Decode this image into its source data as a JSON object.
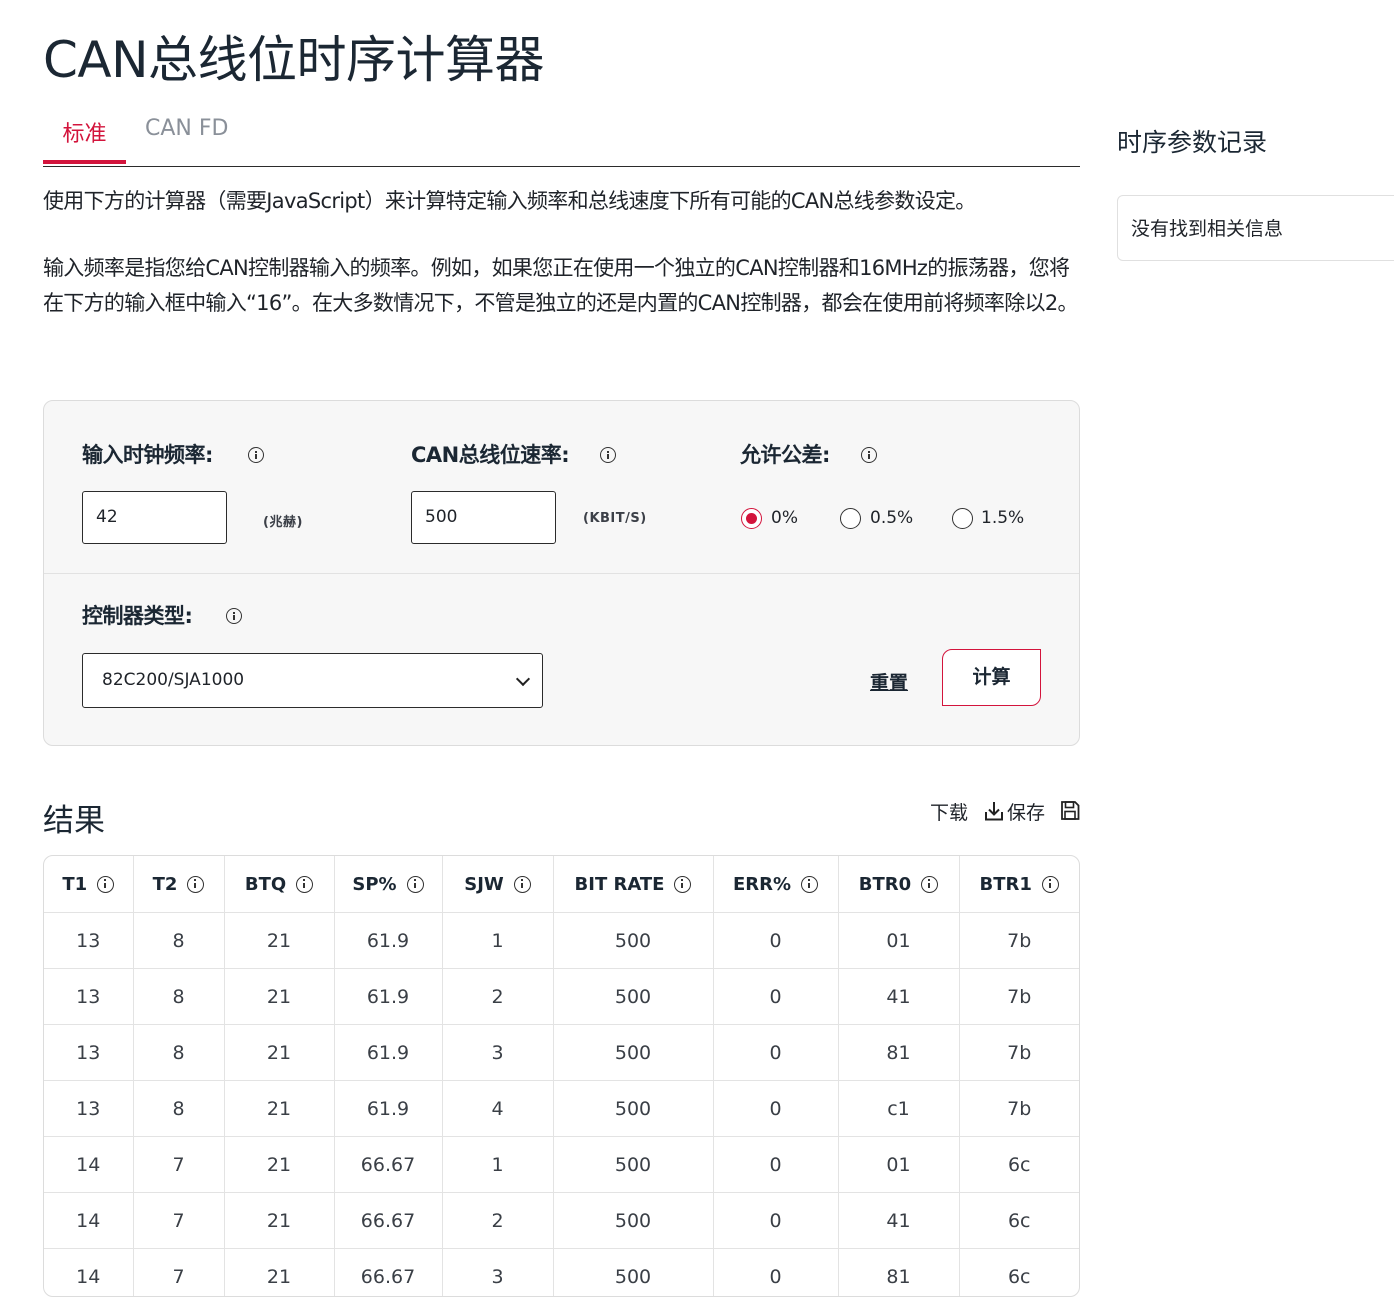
{
  "page": {
    "title": "CAN总线位时序计算器"
  },
  "tabs": [
    {
      "label": "标准",
      "active": true
    },
    {
      "label": "CAN FD",
      "active": false
    }
  ],
  "intro": {
    "p1": "使用下方的计算器（需要JavaScript）来计算特定输入频率和总线速度下所有可能的CAN总线参数设定。",
    "p2": "输入频率是指您给CAN控制器输入的频率。例如，如果您正在使用一个独立的CAN控制器和16MHz的振荡器，您将在下方的输入框中输入“16”。在大多数情况下，不管是独立的还是内置的CAN控制器，都会在使用前将频率除以2。"
  },
  "calculator": {
    "clock": {
      "label": "输入时钟频率:",
      "value": "42",
      "unit": "(兆赫)"
    },
    "bitrate": {
      "label": "CAN总线位速率:",
      "value": "500",
      "unit": "(KBIT/S)"
    },
    "tolerance": {
      "label": "允许公差:",
      "options": [
        {
          "label": "0%",
          "checked": true
        },
        {
          "label": "0.5%",
          "checked": false
        },
        {
          "label": "1.5%",
          "checked": false
        }
      ]
    },
    "controller": {
      "label": "控制器类型:",
      "selected": "82C200/SJA1000"
    },
    "reset_label": "重置",
    "calc_label": "计算",
    "accent": "#d3143c"
  },
  "results": {
    "title": "结果",
    "download_label": "下载",
    "save_label": "保存",
    "columns": [
      "T1",
      "T2",
      "BTQ",
      "SP%",
      "SJW",
      "BIT RATE",
      "ERR%",
      "BTR0",
      "BTR1"
    ],
    "rows": [
      [
        "13",
        "8",
        "21",
        "61.9",
        "1",
        "500",
        "0",
        "01",
        "7b"
      ],
      [
        "13",
        "8",
        "21",
        "61.9",
        "2",
        "500",
        "0",
        "41",
        "7b"
      ],
      [
        "13",
        "8",
        "21",
        "61.9",
        "3",
        "500",
        "0",
        "81",
        "7b"
      ],
      [
        "13",
        "8",
        "21",
        "61.9",
        "4",
        "500",
        "0",
        "c1",
        "7b"
      ],
      [
        "14",
        "7",
        "21",
        "66.67",
        "1",
        "500",
        "0",
        "01",
        "6c"
      ],
      [
        "14",
        "7",
        "21",
        "66.67",
        "2",
        "500",
        "0",
        "41",
        "6c"
      ],
      [
        "14",
        "7",
        "21",
        "66.67",
        "3",
        "500",
        "0",
        "81",
        "6c"
      ]
    ]
  },
  "sidebar": {
    "title": "时序参数记录",
    "empty_text": "没有找到相关信息"
  },
  "icons": {
    "info": "info-icon",
    "download": "download-icon",
    "save": "floppy-disk-icon",
    "dropdown": "chevron-down-icon"
  }
}
